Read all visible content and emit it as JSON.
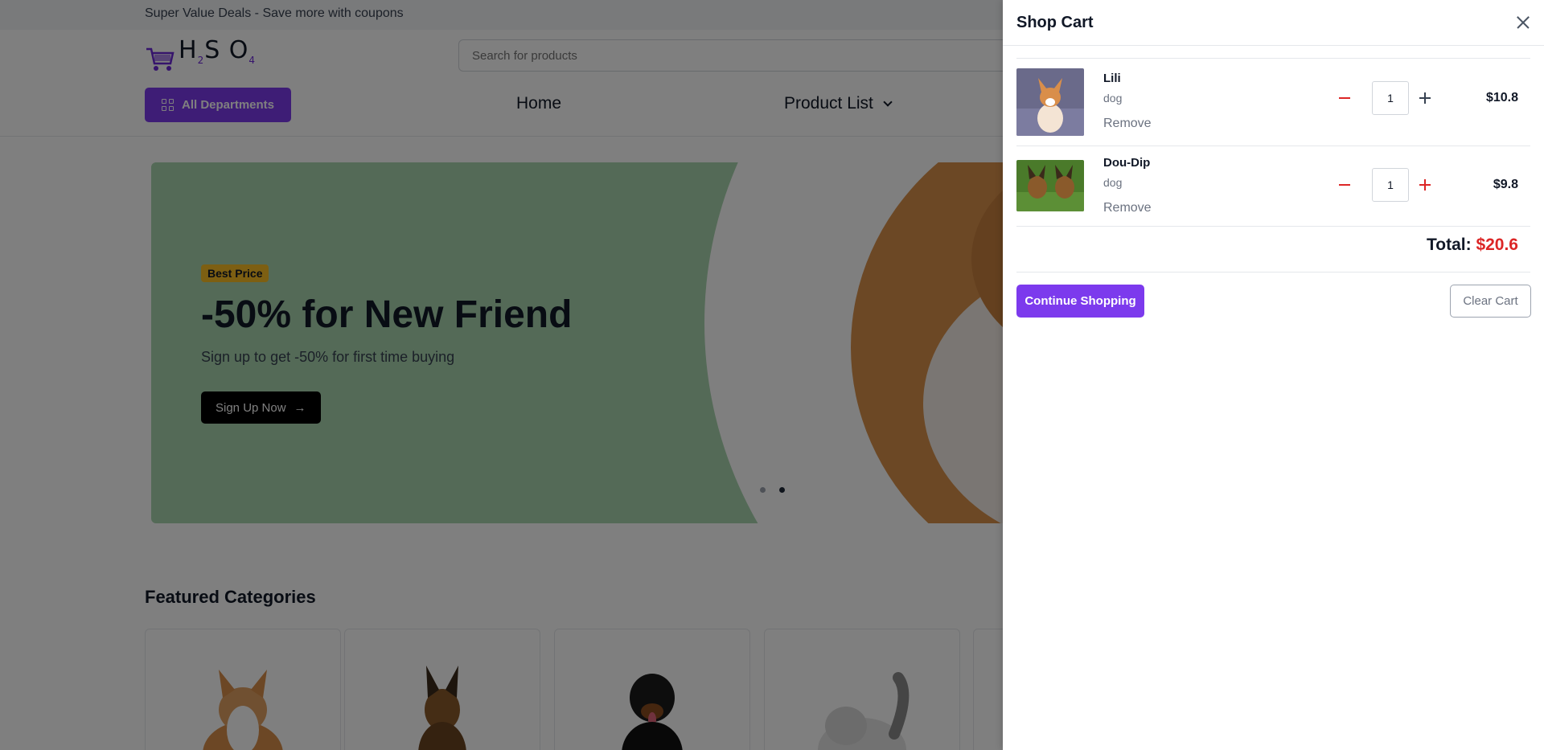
{
  "topbar": {
    "text": "Super Value Deals - Save more with coupons"
  },
  "header": {
    "search_placeholder": "Search for products",
    "departments_label": "All Departments",
    "nav": {
      "home": "Home",
      "product_list": "Product List"
    }
  },
  "logo": {
    "h": "H",
    "sub2": "2",
    "s": "S",
    "o": "O",
    "sub4": "4"
  },
  "hero": {
    "badge": "Best Price",
    "title": "-50% for New Friend",
    "subtitle": "Sign up to get -50% for first time buying",
    "cta": "Sign Up Now",
    "cta_arrow": "→",
    "active_slide": 2,
    "slide_count": 2
  },
  "featured": {
    "title": "Featured Categories"
  },
  "cart": {
    "title": "Shop Cart",
    "items": [
      {
        "name": "Lili",
        "category": "dog",
        "quantity": "1",
        "price": "$10.8",
        "remove_label": "Remove"
      },
      {
        "name": "Dou-Dip",
        "category": "dog",
        "quantity": "1",
        "price": "$9.8",
        "remove_label": "Remove"
      }
    ],
    "total_label": "Total:",
    "total_value": "$20.6",
    "continue_label": "Continue Shopping",
    "clear_label": "Clear Cart"
  },
  "colors": {
    "accent": "#7c3aed",
    "danger": "#dc2626",
    "hero_bg": "#a8d5ae",
    "badge": "#fbbf24"
  }
}
